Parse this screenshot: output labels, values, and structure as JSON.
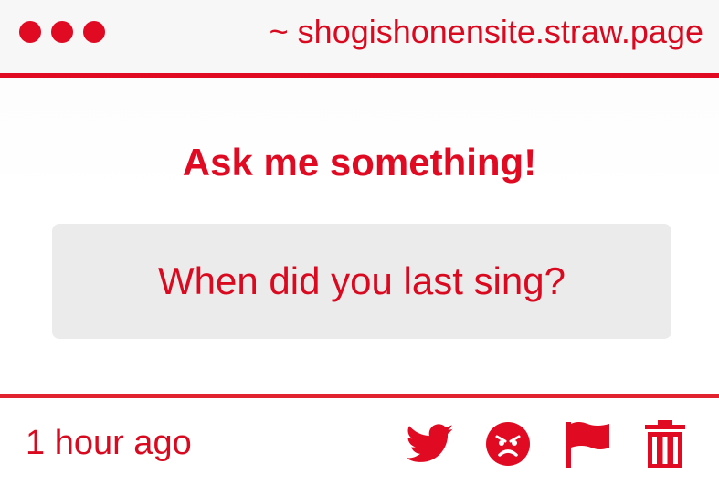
{
  "window": {
    "url": "~ shogishonensite.straw.page",
    "controls": [
      "close",
      "minimize",
      "maximize"
    ]
  },
  "main": {
    "heading": "Ask me something!",
    "question": "When did you last sing?"
  },
  "footer": {
    "timestamp": "1 hour ago",
    "actions": [
      {
        "name": "share-twitter",
        "icon": "twitter-bird-icon"
      },
      {
        "name": "react-angry",
        "icon": "angry-face-icon"
      },
      {
        "name": "report",
        "icon": "flag-icon"
      },
      {
        "name": "delete",
        "icon": "trash-icon"
      }
    ]
  },
  "colors": {
    "accent": "#e00a22",
    "question_bg": "#ecebec",
    "background": "#ffffff"
  }
}
